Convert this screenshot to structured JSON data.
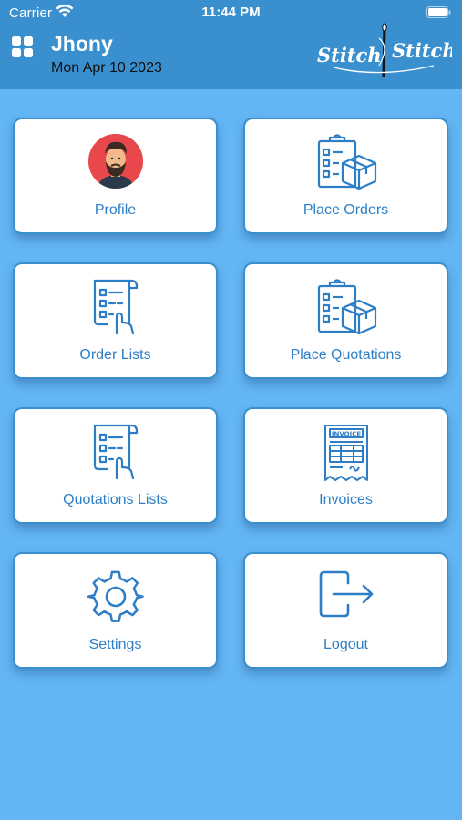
{
  "status_bar": {
    "carrier": "Carrier",
    "time": "11:44 PM"
  },
  "header": {
    "user_name": "Jhony",
    "date": "Mon Apr 10 2023",
    "logo_text": "Stitch Stitch"
  },
  "menu": {
    "profile": "Profile",
    "place_orders": "Place Orders",
    "order_lists": "Order Lists",
    "place_quotations": "Place Quotations",
    "quotations_lists": "Quotations Lists",
    "invoices": "Invoices",
    "settings": "Settings",
    "logout": "Logout"
  },
  "icons": {
    "profile": "avatar-icon",
    "place_orders": "clipboard-box-icon",
    "order_lists": "checklist-hand-icon",
    "place_quotations": "clipboard-box-icon",
    "quotations_lists": "checklist-hand-icon",
    "invoices": "invoice-icon",
    "settings": "gear-icon",
    "logout": "logout-icon"
  },
  "colors": {
    "background": "#64b5f4",
    "header": "#3a8fce",
    "accent": "#2d7ec6",
    "avatar_bg": "#e8474b"
  }
}
